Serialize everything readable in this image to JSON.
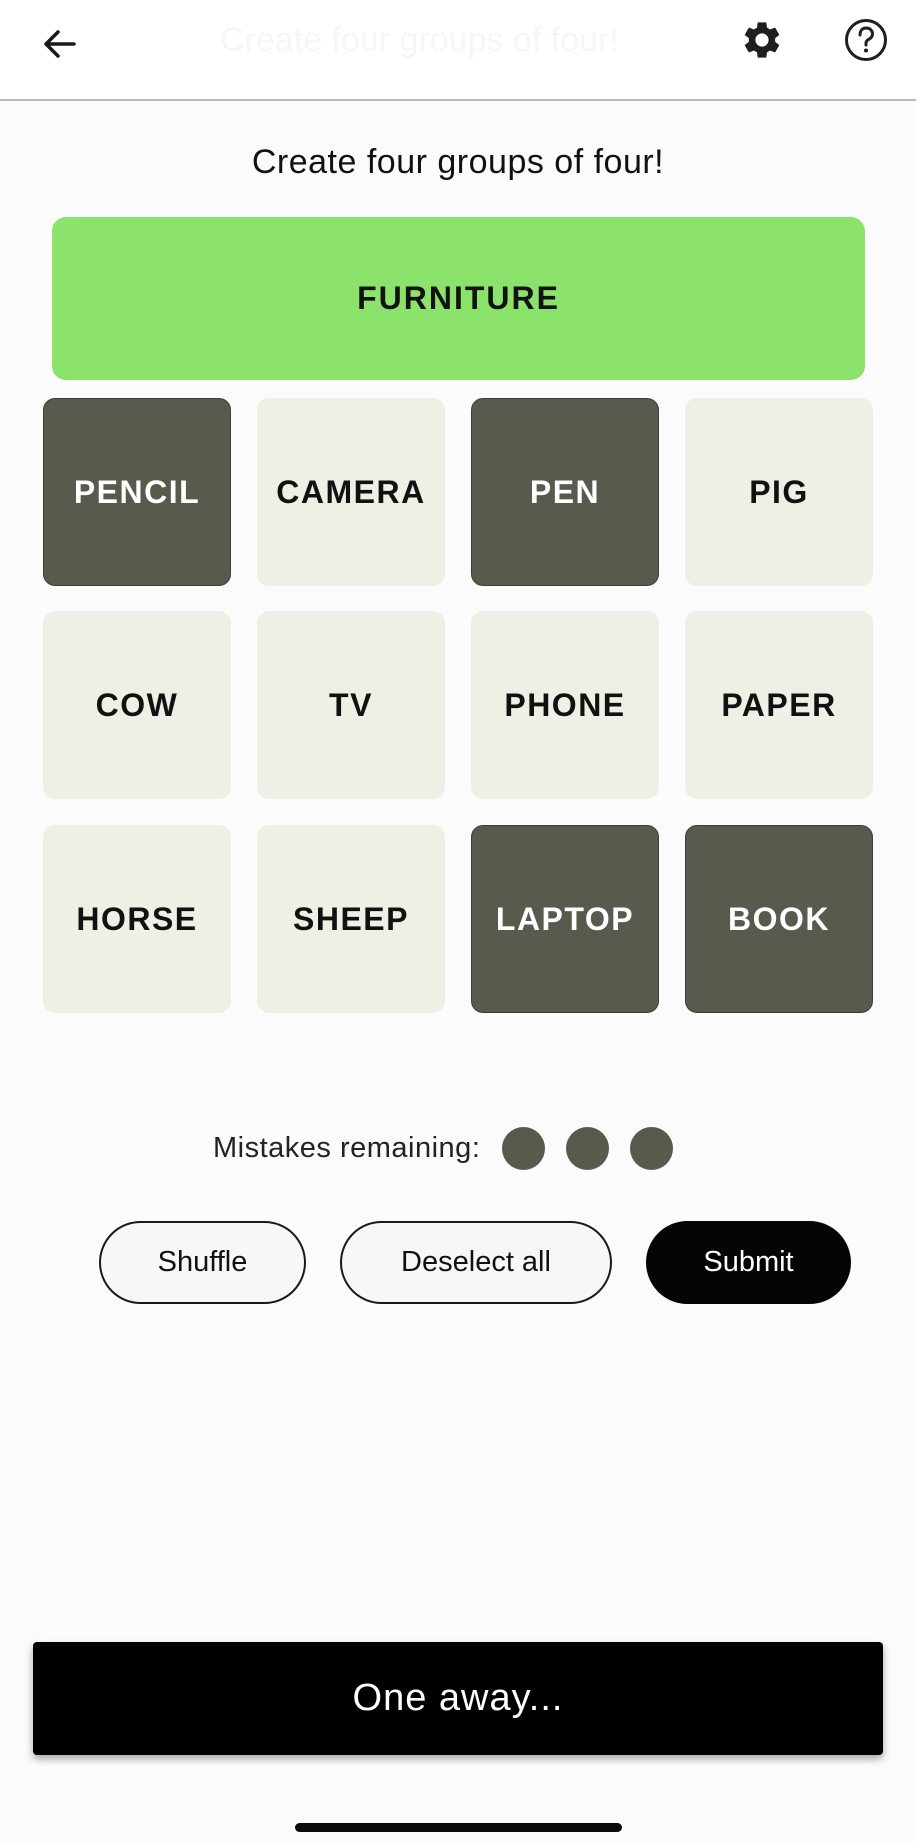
{
  "header": {
    "title": "Create four groups of four!",
    "back_icon": "arrow-left-icon",
    "settings_icon": "gear-icon",
    "help_icon": "question-circle-icon"
  },
  "subtitle": "Create four groups of four!",
  "solved_groups": [
    {
      "label": "FURNITURE",
      "color": "#8be36b"
    }
  ],
  "tiles": [
    {
      "label": "PENCIL",
      "selected": true
    },
    {
      "label": "CAMERA",
      "selected": false
    },
    {
      "label": "PEN",
      "selected": true
    },
    {
      "label": "PIG",
      "selected": false
    },
    {
      "label": "COW",
      "selected": false
    },
    {
      "label": "TV",
      "selected": false
    },
    {
      "label": "PHONE",
      "selected": false
    },
    {
      "label": "PAPER",
      "selected": false
    },
    {
      "label": "HORSE",
      "selected": false
    },
    {
      "label": "SHEEP",
      "selected": false
    },
    {
      "label": "LAPTOP",
      "selected": true
    },
    {
      "label": "BOOK",
      "selected": true
    }
  ],
  "mistakes": {
    "label": "Mistakes remaining:",
    "remaining": 3
  },
  "actions": {
    "shuffle_label": "Shuffle",
    "deselect_label": "Deselect all",
    "submit_label": "Submit"
  },
  "toast": {
    "message": "One away..."
  },
  "colors": {
    "tile_default": "#efefe6",
    "tile_selected": "#5a594e",
    "solved_green": "#8be36b",
    "submit_bg": "#050505"
  }
}
